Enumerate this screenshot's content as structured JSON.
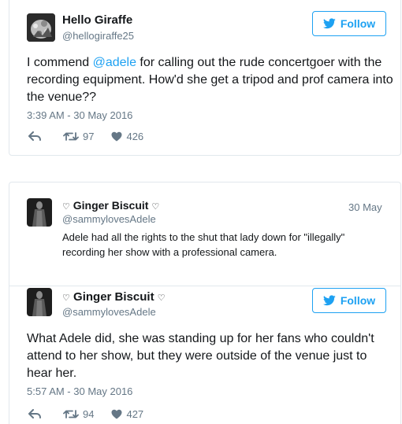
{
  "tweet1": {
    "name": "Hello Giraffe",
    "handle": "@hellogiraffe25",
    "follow_label": "Follow",
    "text_before": "I commend ",
    "mention": "@adele",
    "text_after": " for calling out the rude concertgoer with the recording equipment. How'd she get a tripod and prof camera into the venue??",
    "timestamp": "3:39 AM - 30 May 2016",
    "retweets": "97",
    "likes": "426"
  },
  "quoted": {
    "name": "Ginger Biscuit",
    "name_prefix": "♡",
    "name_suffix": "♡",
    "handle": "@sammylovesAdele",
    "date": "30 May",
    "text": "Adele had all the rights to the shut that lady down for \"illegally\" recording her show with a professional camera."
  },
  "tweet2": {
    "name": "Ginger Biscuit",
    "name_prefix": "♡",
    "name_suffix": "♡",
    "handle": "@sammylovesAdele",
    "follow_label": "Follow",
    "text": "What Adele did, she was standing up for her fans who couldn't attend to her show, but they were outside of the venue just to hear her.",
    "timestamp": "5:57 AM - 30 May 2016",
    "retweets": "94",
    "likes": "427"
  },
  "colors": {
    "accent": "#1da1f2",
    "muted": "#657786",
    "border": "#e1e8ed"
  },
  "icons": [
    "reply-icon",
    "retweet-icon",
    "like-icon",
    "twitter-bird-icon"
  ]
}
